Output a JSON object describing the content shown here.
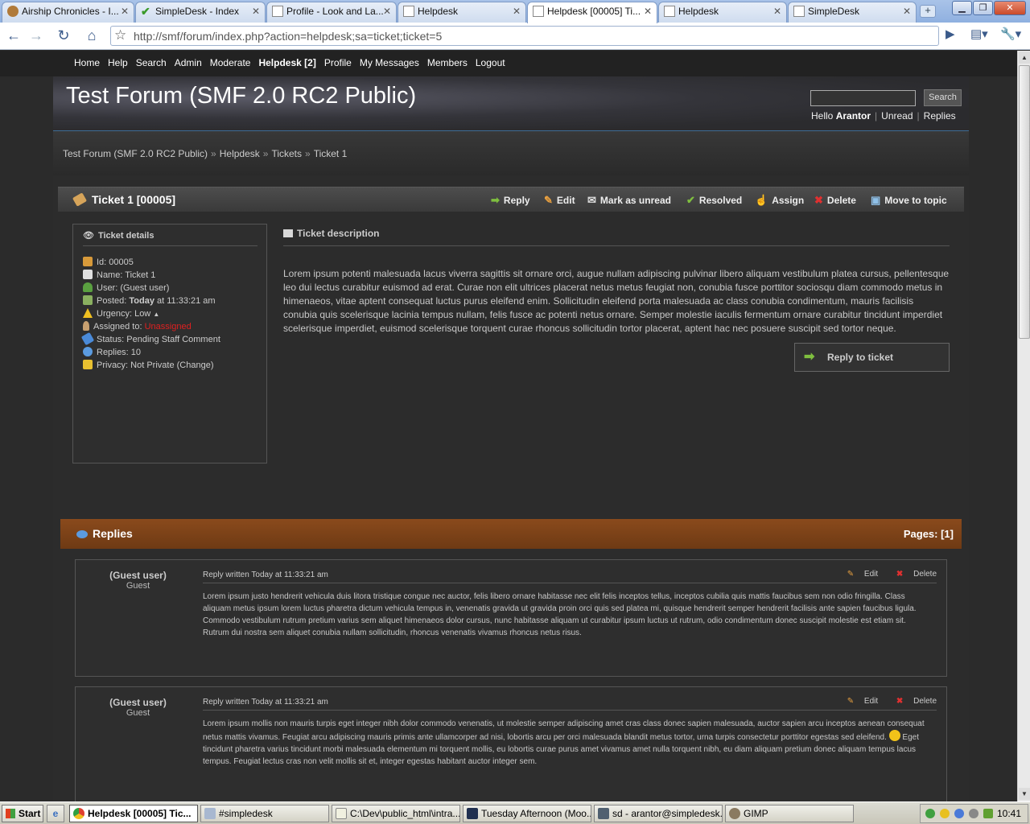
{
  "browser": {
    "tabs": [
      {
        "label": "Airship Chronicles - I..."
      },
      {
        "label": "SimpleDesk - Index"
      },
      {
        "label": "Profile - Look and La..."
      },
      {
        "label": "Helpdesk"
      },
      {
        "label": "Helpdesk [00005] Ti..."
      },
      {
        "label": "Helpdesk"
      },
      {
        "label": "SimpleDesk"
      }
    ],
    "active_tab": 4,
    "url": "http://smf/forum/index.php?action=helpdesk;sa=ticket;ticket=5"
  },
  "menu": [
    "Home",
    "Help",
    "Search",
    "Admin",
    "Moderate",
    "Helpdesk [2]",
    "Profile",
    "My Messages",
    "Members",
    "Logout"
  ],
  "header": {
    "forum_title": "Test Forum (SMF 2.0 RC2 Public)",
    "search_button": "Search",
    "hello": "Hello",
    "username": "Arantor",
    "unread": "Unread",
    "replies": "Replies"
  },
  "breadcrumb": [
    "Test Forum (SMF 2.0 RC2 Public)",
    "Helpdesk",
    "Tickets",
    "Ticket 1"
  ],
  "breadcrumb_sep": "»",
  "ticket": {
    "title": "Ticket 1  [00005]",
    "actions": [
      "Reply",
      "Edit",
      "Mark as unread",
      "Resolved",
      "Assign",
      "Delete",
      "Move to topic"
    ],
    "details_heading": "Ticket details",
    "details": {
      "id": "Id: 00005",
      "name": "Name: Ticket 1",
      "user": "User: (Guest user)",
      "posted_label": "Posted:",
      "posted_today": "Today",
      "posted_time": "at 11:33:21 am",
      "urgency": "Urgency: Low",
      "assigned_label": "Assigned to:",
      "assigned_value": "Unassigned",
      "status": "Status: Pending Staff Comment",
      "replies": "Replies: 10",
      "privacy": "Privacy: Not Private (Change)"
    },
    "description_heading": "Ticket description",
    "description": "Lorem ipsum potenti malesuada lacus viverra sagittis sit ornare orci, augue nullam adipiscing pulvinar libero aliquam vestibulum platea cursus, pellentesque leo dui lectus curabitur euismod ad erat. Curae non elit ultrices placerat netus metus feugiat non, conubia fusce porttitor sociosqu diam commodo metus in himenaeos, vitae aptent consequat luctus purus eleifend enim. Sollicitudin eleifend porta malesuada ac class conubia condimentum, mauris facilisis conubia quis scelerisque lacinia tempus nullam, felis fusce ac potenti netus ornare. Semper molestie iaculis fermentum ornare curabitur tincidunt imperdiet scelerisque imperdiet, euismod scelerisque torquent curae rhoncus sollicitudin tortor placerat, aptent hac nec posuere suscipit sed tortor neque.",
    "reply_button": "Reply to ticket"
  },
  "replies_section": {
    "title": "Replies",
    "pages": "Pages: [1]",
    "items": [
      {
        "poster": "(Guest user)",
        "role": "Guest",
        "meta": "Reply written Today at 11:33:21 am",
        "edit": "Edit",
        "delete": "Delete",
        "body": "Lorem ipsum justo hendrerit vehicula duis litora tristique congue nec auctor, felis libero ornare habitasse nec elit felis inceptos tellus, inceptos cubilia quis mattis faucibus sem non odio fringilla. Class aliquam metus ipsum lorem luctus pharetra dictum vehicula tempus in, venenatis gravida ut gravida proin orci quis sed platea mi, quisque hendrerit semper hendrerit facilisis ante sapien faucibus ligula. Commodo vestibulum rutrum pretium varius sem aliquet himenaeos dolor cursus, nunc habitasse aliquam ut curabitur ipsum luctus ut rutrum, odio condimentum donec suscipit molestie est etiam sit. Rutrum dui nostra sem aliquet conubia nullam sollicitudin, rhoncus venenatis vivamus rhoncus netus risus."
      },
      {
        "poster": "(Guest user)",
        "role": "Guest",
        "meta": "Reply written Today at 11:33:21 am",
        "edit": "Edit",
        "delete": "Delete",
        "body_a": "Lorem ipsum mollis non mauris turpis eget integer nibh dolor commodo venenatis, ut molestie semper adipiscing amet cras class donec sapien malesuada, auctor sapien arcu inceptos aenean consequat netus mattis vivamus. Feugiat arcu adipiscing mauris primis ante ullamcorper ad nisi, lobortis arcu per orci malesuada blandit metus tortor, urna turpis consectetur porttitor egestas sed eleifend.",
        "body_b": "Eget tincidunt pharetra varius tincidunt morbi malesuada elementum mi torquent mollis, eu lobortis curae purus amet vivamus amet nulla torquent nibh, eu diam aliquam pretium donec aliquam tempus lacus tempus. Feugiat lectus cras non velit mollis sit et, integer egestas habitant auctor integer sem."
      }
    ]
  },
  "taskbar": {
    "start": "Start",
    "items": [
      "Helpdesk [00005] Tic...",
      "#simpledesk",
      "C:\\Dev\\public_html\\intra...",
      "Tuesday Afternoon (Moo...",
      "sd - arantor@simpledesk...",
      "GIMP"
    ],
    "clock": "10:41"
  }
}
